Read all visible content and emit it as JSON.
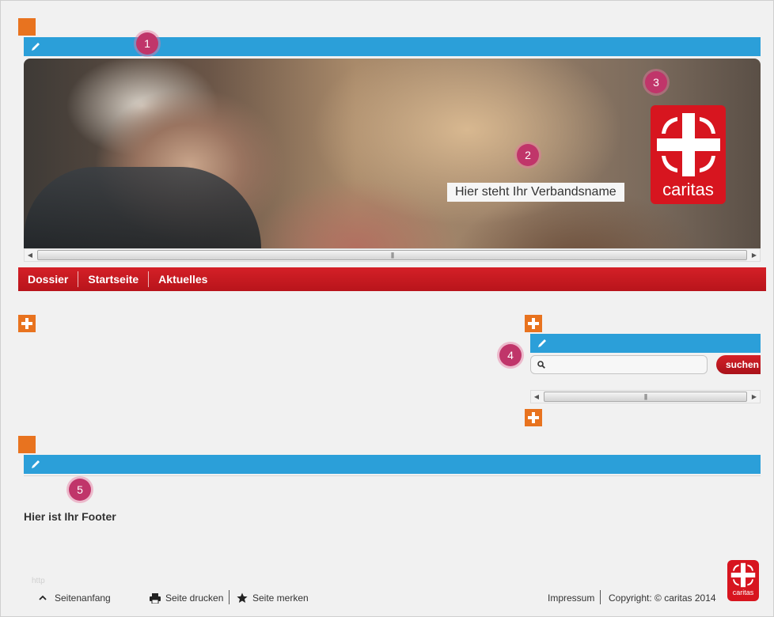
{
  "markers": [
    "1",
    "2",
    "3",
    "4",
    "5"
  ],
  "header": {
    "org_name": "Hier steht Ihr Verbandsname",
    "logo_text": "caritas"
  },
  "nav": {
    "items": [
      "Dossier",
      "Startseite",
      "Aktuelles"
    ]
  },
  "search": {
    "value": "",
    "placeholder": "",
    "button_label": "suchen"
  },
  "footer": {
    "text": "Hier ist Ihr Footer",
    "faint_text": "http"
  },
  "bottom_bar": {
    "back_to_top": "Seitenanfang",
    "print": "Seite drucken",
    "bookmark": "Seite merken",
    "imprint": "Impressum",
    "copyright": "Copyright: © caritas 2014",
    "logo_text": "caritas"
  },
  "colors": {
    "accent_blue": "#2b9fd9",
    "brand_red": "#d7151f",
    "edit_orange": "#e8731f",
    "marker_pink": "#c0356a"
  },
  "icons": [
    "pencil-icon",
    "plus-icon",
    "search-icon",
    "chevron-up-icon",
    "printer-icon",
    "star-icon",
    "caritas-cross-icon"
  ]
}
